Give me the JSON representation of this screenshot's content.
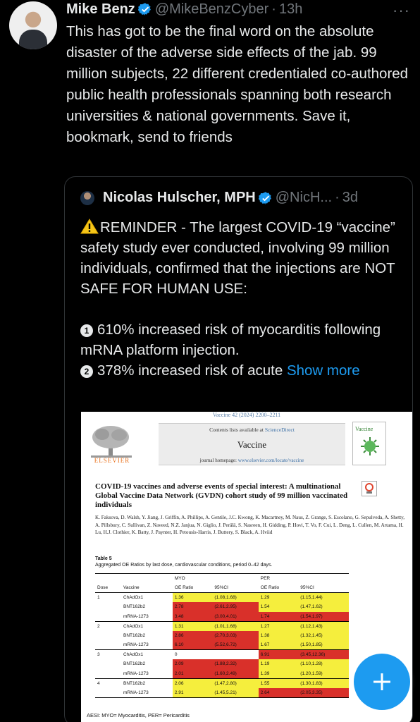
{
  "tweet": {
    "author_name": "Mike Benz",
    "handle": "@MikeBenzCyber",
    "separator": "·",
    "time": "13h",
    "more": "···",
    "text": "This has got to be the final word on the absolute disaster of the adverse side effects of the jab. 99 million subjects, 22 different credentialed co-authored public health professionals spanning both research universities & national governments. Save it, bookmark, send to friends"
  },
  "quote": {
    "author_name": "Nicolas Hulscher, MPH",
    "handle": "@NicH...",
    "separator": "·",
    "time": "3d",
    "reminder_text": "REMINDER - The largest COVID-19 “vaccine” safety study ever conducted, involving 99 million individuals, confirmed that the injections are NOT SAFE FOR HUMAN USE:",
    "point1_num": "1",
    "point1_text": "610% increased risk of myocarditis following mRNA platform injection.",
    "point2_num": "2",
    "point2_text": "378% increased risk of acute",
    "show_more": "Show more"
  },
  "paper": {
    "journal_line": "Vaccine 42 (2024) 2200–2211",
    "contents_prefix": "Contents lists available at ",
    "contents_link": "ScienceDirect",
    "journal_name": "Vaccine",
    "homepage_prefix": "journal homepage: ",
    "homepage_link": "www.elsevier.com/locate/vaccine",
    "publisher": "ELSEVIER",
    "cover_title": "Vaccine",
    "title": "COVID-19 vaccines and adverse events of special interest: A multinational Global Vaccine Data Network (GVDN) cohort study of 99 million vaccinated individuals",
    "authors": "K. Faksova, D. Walsh, Y. Jiang, J. Griffin, A. Phillips, A. Gentile, J.C. Kwong, K. Macartney, M. Naus, Z. Grange, S. Escolano, G. Sepulveda, A. Shetty, A. Pillsbury, C. Sullivan, Z. Naveed, N.Z. Janjua, N. Giglio, J. Perälä, S. Nasreen, H. Gidding, P. Hovi, T. Vo, F. Cui, L. Deng, L. Cullen, M. Artama, H. Lu, H.J. Clothier, K. Batty, J. Paynter, H. Petousis-Harris, J. Buttery, S. Black, A. Hviid",
    "table_label": "Table 5",
    "table_caption": "Aggregated OE Ratios by last dose, cardiovascular conditions, period 0–42 days.",
    "table": {
      "group_headers": [
        "MYO",
        "PER"
      ],
      "columns": [
        "Dose",
        "Vaccine",
        "OE Ratio",
        "95%CI",
        "OE Ratio",
        "95%CI"
      ],
      "rows": [
        {
          "dose": "1",
          "vaccine": "ChAdOx1",
          "myo_oe": "1.36",
          "myo_ci": "(1.08,1.68)",
          "per_oe": "1.29",
          "per_ci": "(1.15,1.44)",
          "hl": [
            "y",
            "y",
            "y",
            "y"
          ]
        },
        {
          "dose": "",
          "vaccine": "BNT162b2",
          "myo_oe": "2.78",
          "myo_ci": "(2.61,2.95)",
          "per_oe": "1.54",
          "per_ci": "(1.47,1.62)",
          "hl": [
            "r",
            "r",
            "y",
            "y"
          ]
        },
        {
          "dose": "",
          "vaccine": "mRNA-1273",
          "myo_oe": "3.48",
          "myo_ci": "(3.00,4.01)",
          "per_oe": "1.74",
          "per_ci": "(1.54,1.97)",
          "hl": [
            "r",
            "r",
            "r",
            "r"
          ]
        },
        {
          "dose": "2",
          "vaccine": "ChAdOx1",
          "myo_oe": "1.31",
          "myo_ci": "(1.01,1.68)",
          "per_oe": "1.27",
          "per_ci": "(1.12,1.43)",
          "hl": [
            "y",
            "y",
            "y",
            "y"
          ]
        },
        {
          "dose": "",
          "vaccine": "BNT162b2",
          "myo_oe": "2.86",
          "myo_ci": "(2.70,3.03)",
          "per_oe": "1.38",
          "per_ci": "(1.32,1.45)",
          "hl": [
            "r",
            "r",
            "y",
            "y"
          ]
        },
        {
          "dose": "",
          "vaccine": "mRNA-1273",
          "myo_oe": "6.10",
          "myo_ci": "(5.52,6.72)",
          "per_oe": "1.67",
          "per_ci": "(1.50,1.85)",
          "hl": [
            "r",
            "r",
            "y",
            "y"
          ]
        },
        {
          "dose": "3",
          "vaccine": "ChAdOx1",
          "myo_oe": "0",
          "myo_ci": "",
          "per_oe": "6.91",
          "per_ci": "(3.45,12.36)",
          "hl": [
            "",
            "",
            "r",
            "r"
          ]
        },
        {
          "dose": "",
          "vaccine": "BNT162b2",
          "myo_oe": "2.09",
          "myo_ci": "(1.88,2.32)",
          "per_oe": "1.19",
          "per_ci": "(1.10,1.28)",
          "hl": [
            "r",
            "r",
            "y",
            "y"
          ]
        },
        {
          "dose": "",
          "vaccine": "mRNA-1273",
          "myo_oe": "2.01",
          "myo_ci": "(1.60,2.49)",
          "per_oe": "1.39",
          "per_ci": "(1.20,1.59)",
          "hl": [
            "r",
            "r",
            "y",
            "y"
          ]
        },
        {
          "dose": "4",
          "vaccine": "BNT162b2",
          "myo_oe": "2.06",
          "myo_ci": "(1.47,2.80)",
          "per_oe": "1.55",
          "per_ci": "(1.30,1.83)",
          "hl": [
            "y",
            "y",
            "y",
            "y"
          ]
        },
        {
          "dose": "",
          "vaccine": "mRNA-1273",
          "myo_oe": "2.91",
          "myo_ci": "(1.45,5.21)",
          "per_oe": "2.64",
          "per_ci": "(2.05,3.35)",
          "hl": [
            "y",
            "y",
            "r",
            "r"
          ]
        }
      ]
    },
    "footnote": "AESI: MYO= Myocarditis, PER= Pericarditis"
  },
  "compose_button": {
    "icon": "plus-icon"
  },
  "colors": {
    "background": "#000000",
    "text": "#e7e9ea",
    "secondary": "#71767b",
    "accent": "#1d9bf0",
    "highlight_yellow": "#f5ee3d",
    "highlight_red": "#d9302a"
  }
}
